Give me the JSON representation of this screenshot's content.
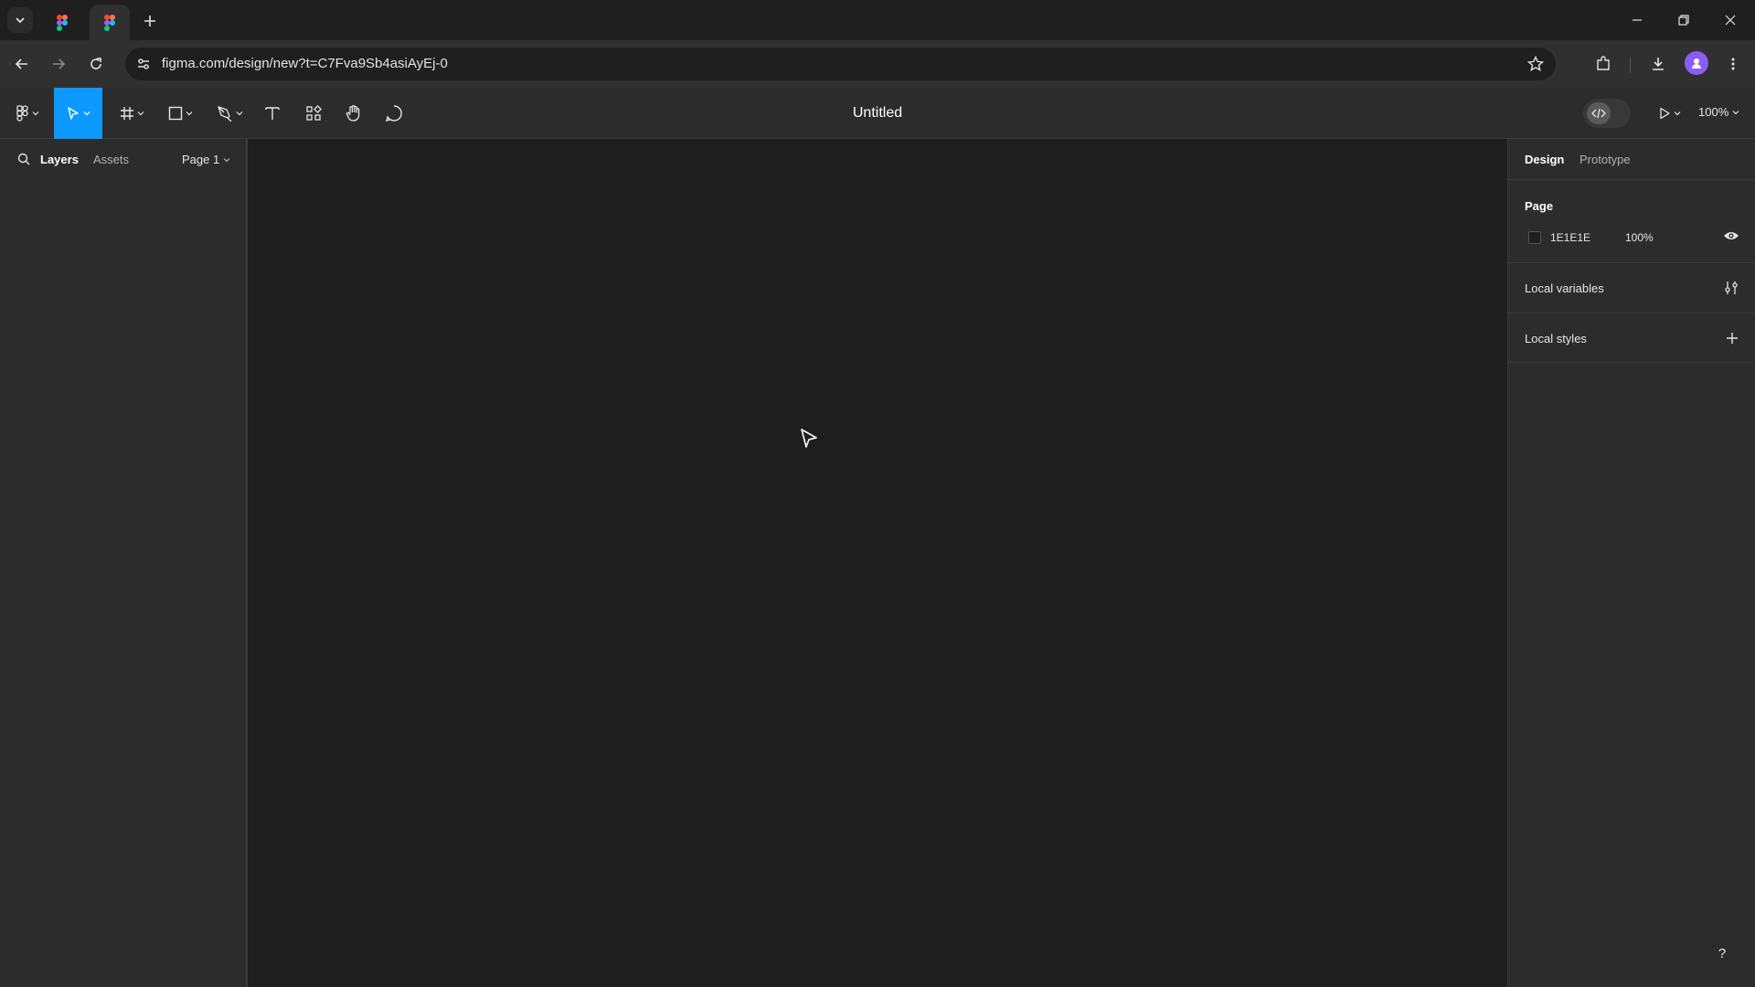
{
  "browser": {
    "url": "figma.com/design/new?t=C7Fva9Sb4asiAyEj-0"
  },
  "toolbar": {
    "title": "Untitled",
    "zoom": "100%"
  },
  "left_panel": {
    "tabs": [
      {
        "label": "Layers"
      },
      {
        "label": "Assets"
      }
    ],
    "page_selector": "Page 1"
  },
  "right_panel": {
    "tabs": [
      {
        "label": "Design"
      },
      {
        "label": "Prototype"
      }
    ],
    "page_section": {
      "title": "Page",
      "fill_hex": "1E1E1E",
      "opacity": "100%"
    },
    "local_variables": "Local variables",
    "local_styles": "Local styles"
  },
  "help_label": "?",
  "colors": {
    "accent": "#0d99ff",
    "panel": "#2c2c2c",
    "canvas": "#1e1e1e"
  }
}
